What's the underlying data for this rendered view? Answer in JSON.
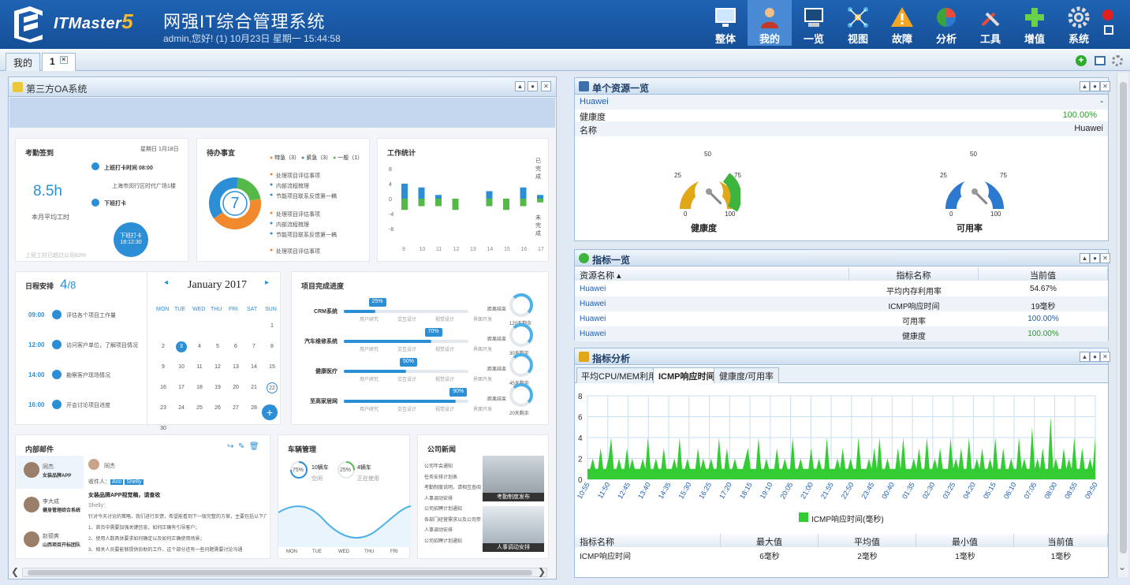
{
  "header": {
    "brand": "ITMaster",
    "brand_num": "5",
    "title": "网强IT综合管理系统",
    "user_line": "admin,您好! (1) 10月23日 星期一 15:44:58",
    "nav": [
      {
        "label": "整体",
        "icon": "monitor-icon"
      },
      {
        "label": "我的",
        "icon": "person-icon"
      },
      {
        "label": "一览",
        "icon": "screen-icon"
      },
      {
        "label": "视图",
        "icon": "network-icon"
      },
      {
        "label": "故障",
        "icon": "warning-icon"
      },
      {
        "label": "分析",
        "icon": "pie-icon"
      },
      {
        "label": "工具",
        "icon": "tools-icon"
      },
      {
        "label": "增值",
        "icon": "plus-icon"
      },
      {
        "label": "系统",
        "icon": "gear-icon"
      }
    ]
  },
  "tabs": [
    {
      "label": "我的"
    },
    {
      "label": "1"
    }
  ],
  "oa": {
    "title": "第三方OA系统",
    "attendance": {
      "title": "考勤签到",
      "date": "星期日  1月18日",
      "hours": "8.5h",
      "hours_label": "本月平均工时",
      "checkin_label": "上班打卡时间 08:00",
      "location": "上海市闵行区时代广场1楼",
      "checkout_label": "下班打卡",
      "button": "下班打卡",
      "button_time": "18:12:30",
      "footer": "上班工时已超过公司63%"
    },
    "todo": {
      "title": "待办事宜",
      "legend": [
        "特急（3）",
        "紧急（3）",
        "一般（1）"
      ],
      "count": "7",
      "items": [
        "处理项目评估事项",
        "内部流程梳理",
        "节能项目联系反馈第一稿",
        "处理项目评估事项",
        "内部流程梳理",
        "节能项目联系反馈第一稿",
        "处理项目评估事项"
      ]
    },
    "work": {
      "title": "工作统计",
      "yticks": [
        "8",
        "4",
        "0",
        "-4",
        "-8"
      ],
      "xticks": [
        "9",
        "10",
        "11",
        "12",
        "13",
        "14",
        "15",
        "16",
        "17"
      ],
      "side_top": "已完成",
      "side_bottom": "未完成",
      "chart_data": {
        "type": "bar",
        "categories": [
          "9",
          "10",
          "11",
          "12",
          "13",
          "14",
          "15",
          "16",
          "17"
        ],
        "series": [
          {
            "name": "已完成",
            "values": [
              4,
              3,
              1,
              0,
              0,
              2,
              0,
              3,
              1
            ]
          },
          {
            "name": "未完成",
            "values": [
              -3,
              -2,
              -2,
              -3,
              0,
              -2,
              -3,
              -2,
              -1
            ]
          }
        ],
        "ylim": [
          -8,
          8
        ]
      }
    },
    "schedule": {
      "title": "日程安排",
      "count": "4",
      "total": "/8",
      "items": [
        {
          "time": "09:00",
          "text": "评估各个项目工作量"
        },
        {
          "time": "12:00",
          "text": "访问客户单位，了解项目情况"
        },
        {
          "time": "14:00",
          "text": "勘察客户现场情况"
        },
        {
          "time": "16:00",
          "text": "开会讨论项目进度"
        }
      ]
    },
    "calendar": {
      "month": "January 2017",
      "days": [
        "MON",
        "TUE",
        "WED",
        "THU",
        "FRI",
        "SAT",
        "SUN"
      ],
      "cells": [
        "",
        "",
        "",
        "",
        "",
        "",
        "1",
        "2",
        "3",
        "4",
        "5",
        "6",
        "7",
        "8",
        "9",
        "10",
        "11",
        "12",
        "13",
        "14",
        "15",
        "16",
        "17",
        "18",
        "19",
        "20",
        "21",
        "22",
        "23",
        "24",
        "25",
        "26",
        "27",
        "28",
        "29",
        "30"
      ],
      "selected": "3",
      "ring": "22"
    },
    "progress": {
      "title": "项目完成进度",
      "projects": [
        {
          "name": "CRM系统",
          "pct": 25,
          "gauge": "120天剩余"
        },
        {
          "name": "汽车维修系统",
          "pct": 70,
          "gauge": "30天剩余"
        },
        {
          "name": "健康医疗",
          "pct": 50,
          "gauge": "45天剩余"
        },
        {
          "name": "至高家居网",
          "pct": 90,
          "gauge": "20天剩余"
        }
      ],
      "stages": [
        "用户研究",
        "交互设计",
        "视觉设计",
        "界面开发"
      ],
      "gauge_label": "距离结束"
    },
    "mail": {
      "title": "内部邮件",
      "list": [
        {
          "name": "同杰",
          "subject": "女装品牌APP"
        },
        {
          "name": "李大成",
          "subject": "健身管理综合系统"
        },
        {
          "name": "赵德爽",
          "subject": "山西项目开标团队"
        }
      ],
      "reader": {
        "from": "同杰",
        "to_label": "收件人：",
        "to": [
          "Ann",
          "Shelly"
        ],
        "subject": "女装品牌APP视觉稿，请查收",
        "greet": "Shelly：",
        "body": [
          "针对今天讨论的策略，我们进行反馈，希望能看到下一版完整的方案，主要包括以下几个关键问题：",
          "1、首页中需要加强关键信息，如何正确有引导客户；",
          "2、使用人数具体要求如何确定以及如何正确使用场景；",
          "3、相关人员要能够提供协助的工作，这个部分还有一些问题需要讨论沟通"
        ]
      }
    },
    "vehicle": {
      "title": "车辆管理",
      "a_pct": "75%",
      "a_count": "10辆车",
      "a_label": "空闲",
      "b_pct": "25%",
      "b_count": "4辆车",
      "b_label": "正在使用",
      "days": [
        "MON",
        "TUE",
        "WED",
        "THU",
        "FRI"
      ]
    },
    "news": {
      "title": "公司新闻",
      "items": [
        "公司年会通知",
        "任务安排计划表",
        "考勤制度说明，请相互查阅",
        "人事调动安排",
        "公司招聘计划通知",
        "各部门经营需求以及公司参阅",
        "人事调动安排",
        "公司招聘计划通知"
      ],
      "img1": "考勤制度发布",
      "img2": "人事调动安排"
    }
  },
  "single": {
    "title": "单个资源一览",
    "resource": "Huawei",
    "dash": "-",
    "health_label": "健康度",
    "health_val": "100.00%",
    "name_label": "名称",
    "name_val": "Huawei",
    "gauges": [
      {
        "label": "健康度",
        "min": "0",
        "q1": "25",
        "mid": "50",
        "q3": "75",
        "max": "100",
        "value": 100,
        "color": "#e0a818"
      },
      {
        "label": "可用率",
        "min": "0",
        "q1": "25",
        "mid": "50",
        "q3": "75",
        "max": "100",
        "value": 100,
        "color": "#2c79cf"
      }
    ]
  },
  "metrics": {
    "title": "指标一览",
    "headers": [
      "资源名称",
      "指标名称",
      "当前值"
    ],
    "rows": [
      {
        "res": "Huawei",
        "metric": "平均内存利用率",
        "val": "54.67%",
        "color": "#222"
      },
      {
        "res": "Huawei",
        "metric": "ICMP响应时间",
        "val": "19毫秒",
        "color": "#222"
      },
      {
        "res": "Huawei",
        "metric": "可用率",
        "val": "100.00%",
        "color": "#1a5fb4"
      },
      {
        "res": "Huawei",
        "metric": "健康度",
        "val": "100.00%",
        "color": "#2b9a2b"
      }
    ]
  },
  "analysis": {
    "title": "指标分析",
    "tabs": [
      "平均CPU/MEM利用率",
      "ICMP响应时间",
      "健康度/可用率"
    ],
    "chart_data": {
      "type": "area",
      "series": [
        {
          "name": "ICMP响应时间(毫秒)",
          "values": [
            1,
            1,
            2,
            1,
            1,
            3,
            1,
            1,
            2,
            4,
            1,
            1,
            2,
            1,
            1,
            3,
            1,
            2,
            1,
            1,
            1,
            2,
            1,
            4,
            1,
            1,
            2,
            1,
            1,
            3,
            1,
            1,
            1,
            2,
            1,
            4,
            1,
            1,
            2,
            1,
            1,
            1,
            3,
            1,
            2,
            1,
            1,
            2,
            1,
            1,
            4,
            1,
            1,
            3,
            1,
            1,
            2,
            1,
            1,
            1,
            2,
            3,
            1,
            1,
            1,
            4,
            1,
            1,
            2,
            1,
            1,
            1,
            3,
            1,
            1,
            2,
            1,
            1,
            4,
            1,
            1,
            2,
            1,
            1,
            1,
            3,
            1,
            1,
            2,
            1,
            1,
            4,
            1,
            1,
            1,
            2,
            1,
            3,
            1,
            1,
            2,
            1,
            1,
            4,
            1,
            1,
            1,
            2,
            1,
            3,
            1,
            4,
            1,
            1,
            2,
            1,
            1,
            1,
            3,
            1,
            4,
            1,
            1,
            1,
            2,
            1,
            3,
            1,
            1,
            4,
            1,
            1,
            2,
            1,
            3,
            1,
            1,
            1,
            4,
            1,
            2,
            1,
            3,
            1,
            1,
            4,
            1,
            1,
            2,
            1,
            3,
            1,
            1,
            2,
            1,
            4,
            1,
            1,
            3,
            1,
            1,
            2,
            1,
            1,
            4,
            1,
            2,
            1,
            1,
            5,
            1,
            2,
            1,
            3,
            1,
            1,
            6,
            1,
            2,
            1,
            1,
            3,
            1,
            2,
            1,
            4,
            1,
            1,
            3,
            1,
            1,
            2,
            1,
            4
          ]
        }
      ],
      "xticks": [
        "10:55",
        "11:50",
        "12:45",
        "13:40",
        "14:35",
        "15:30",
        "16:25",
        "17:20",
        "18:15",
        "19:10",
        "20:05",
        "21:00",
        "21:55",
        "22:50",
        "23:45",
        "00:40",
        "01:35",
        "02:30",
        "03:25",
        "04:20",
        "05:15",
        "06:10",
        "07:05",
        "08:00",
        "08:55",
        "09:50"
      ],
      "ylim": [
        0,
        8
      ],
      "yticks": [
        "8",
        "6",
        "4",
        "2",
        "0"
      ],
      "color": "#33cc33",
      "legend": "ICMP响应时间(毫秒)"
    },
    "stats_headers": [
      "指标名称",
      "最大值",
      "平均值",
      "最小值",
      "当前值"
    ],
    "stats_row": [
      "ICMP响应时间",
      "6毫秒",
      "2毫秒",
      "1毫秒",
      "1毫秒"
    ]
  }
}
